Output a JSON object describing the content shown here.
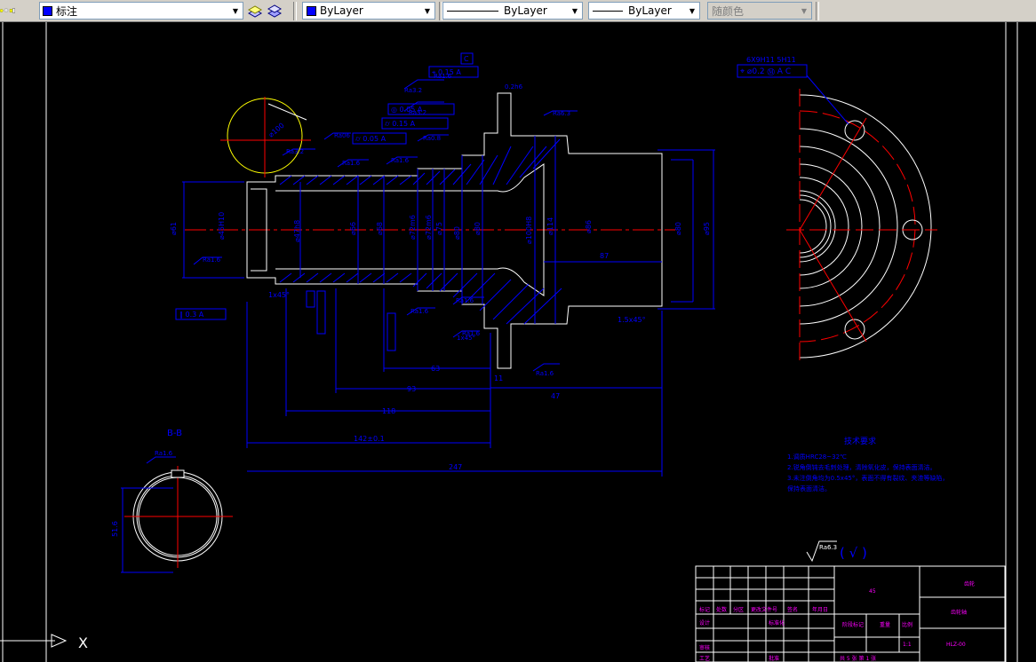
{
  "toolbar": {
    "dim_style": "标注",
    "color_control": "ByLayer",
    "linetype_control": "ByLayer",
    "lineweight_control": "ByLayer",
    "plot_style": "随颜色"
  },
  "drawing": {
    "gdt_frames": [
      {
        "sym": "⌖",
        "val": "0.15",
        "ref": "A"
      },
      {
        "sym": "◎",
        "val": "0.05",
        "ref": "A"
      },
      {
        "sym": "◎",
        "val": "0.15",
        "ref": "A"
      },
      {
        "sym": "⌭",
        "val": "0.05",
        "ref": "A"
      },
      {
        "sym": "∥",
        "val": "0.3",
        "ref": "A"
      }
    ],
    "datum_c": "C",
    "hole_note": "6X9H11 5H11",
    "hole_gdt": "⌖ ⌀0.2 Ⓜ A C",
    "dim_h1": "87",
    "dim_h2": "47",
    "dim_h3": "11",
    "dim_h4": "63",
    "dim_h5": "93",
    "dim_h6": "118",
    "dim_h7": "142±0.1",
    "dim_h8": "247",
    "chamfer": "1.5x45°",
    "chamfer2": "1x45°",
    "section_label": "B-B",
    "section_dim": "51.6",
    "roughness_general": "Ra6.3",
    "roughness_paren": "( √ )",
    "tech_title": "技术要求",
    "tech_lines": [
      "1.调质HRC28~32℃",
      "2.锐角倒钝去毛刺处理，清除氧化皮，保持表面清洁。",
      "3.未注倒角均为0.5x45°，表面不得有裂纹、夹渣等缺陷，",
      "  保持表面清洁。"
    ],
    "title_block": {
      "material": "45",
      "company": "齿轮",
      "part_name": "齿轮轴",
      "drawing_no": "HLZ-00",
      "scale": "1:1",
      "sheet": "共 5 张 第 1 张",
      "header_cells": [
        "标记",
        "处数",
        "分区",
        "更改文件号",
        "签名",
        "年月日"
      ],
      "row_labels": [
        "设计",
        "审核",
        "工艺"
      ],
      "std_label": "标准化",
      "approve_label": "批准",
      "stage_label": "阶段标记",
      "weight_label": "重量",
      "ratio_label": "比例"
    }
  },
  "ucs": {
    "x_label": "X"
  }
}
